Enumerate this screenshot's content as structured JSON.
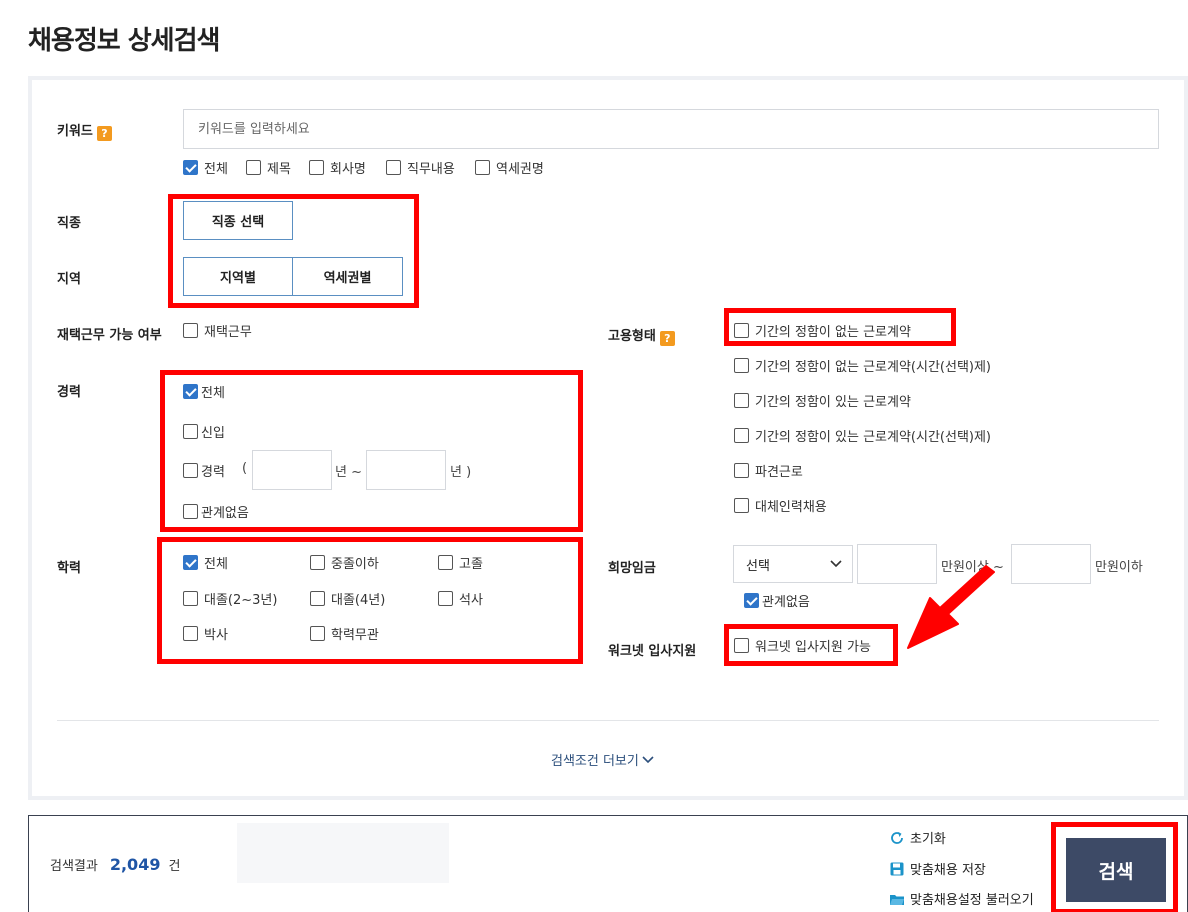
{
  "page_title": "채용정보 상세검색",
  "keyword": {
    "label": "키워드",
    "help": "?",
    "placeholder": "키워드를 입력하세요",
    "options": [
      {
        "label": "전체",
        "checked": true
      },
      {
        "label": "제목",
        "checked": false
      },
      {
        "label": "회사명",
        "checked": false
      },
      {
        "label": "직무내용",
        "checked": false
      },
      {
        "label": "역세권명",
        "checked": false
      }
    ]
  },
  "job_type": {
    "label": "직종",
    "button": "직종 선택"
  },
  "region": {
    "label": "지역",
    "buttons": [
      "지역별",
      "역세권별"
    ]
  },
  "remote": {
    "label": "재택근무 가능 여부",
    "option": {
      "label": "재택근무",
      "checked": false
    }
  },
  "career": {
    "label": "경력",
    "all": {
      "label": "전체",
      "checked": true
    },
    "newbie": {
      "label": "신입",
      "checked": false
    },
    "experienced": {
      "label": "경력",
      "checked": false,
      "open_paren": "(",
      "unit_from": "년 ~",
      "unit_to": "년 )"
    },
    "any": {
      "label": "관계없음",
      "checked": false
    }
  },
  "education": {
    "label": "학력",
    "options": [
      {
        "label": "전체",
        "checked": true
      },
      {
        "label": "중졸이하",
        "checked": false
      },
      {
        "label": "고졸",
        "checked": false
      },
      {
        "label": "대졸(2~3년)",
        "checked": false
      },
      {
        "label": "대졸(4년)",
        "checked": false
      },
      {
        "label": "석사",
        "checked": false
      },
      {
        "label": "박사",
        "checked": false
      },
      {
        "label": "학력무관",
        "checked": false
      }
    ]
  },
  "employment": {
    "label": "고용형태",
    "help": "?",
    "options": [
      {
        "label": "기간의 정함이 없는 근로계약",
        "checked": false
      },
      {
        "label": "기간의 정함이 없는 근로계약(시간(선택)제)",
        "checked": false
      },
      {
        "label": "기간의 정함이 있는 근로계약",
        "checked": false
      },
      {
        "label": "기간의 정함이 있는 근로계약(시간(선택)제)",
        "checked": false
      },
      {
        "label": "파견근로",
        "checked": false
      },
      {
        "label": "대체인력채용",
        "checked": false
      }
    ]
  },
  "salary": {
    "label": "희망임금",
    "select_value": "선택",
    "unit_min": "만원이상 ~",
    "unit_max": "만원이하",
    "any": {
      "label": "관계없음",
      "checked": true
    }
  },
  "worknet": {
    "label": "워크넷 입사지원",
    "option": {
      "label": "워크넷 입사지원 가능",
      "checked": false
    }
  },
  "more_link": "검색조건 더보기",
  "result": {
    "prefix": "검색결과",
    "count": "2,049",
    "suffix": "건"
  },
  "actions": {
    "reset": "초기화",
    "save": "맞춤채용 저장",
    "load": "맞춤채용설정 불러오기"
  },
  "search_button": "검색",
  "colors": {
    "accent": "#2f75c9",
    "search_button": "#3d4a66",
    "help_badge": "#f39a1f",
    "highlight": "#ff0000"
  }
}
